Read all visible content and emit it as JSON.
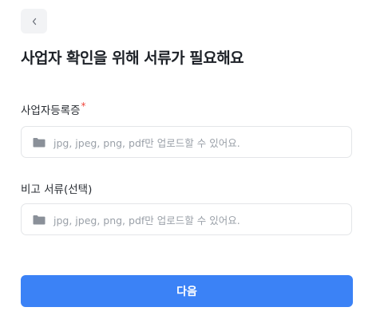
{
  "header": {
    "back_icon": "chevron-left-icon",
    "title": "사업자 확인을 위해 서류가 필요해요"
  },
  "business_registration": {
    "label": "사업자등록증",
    "required_mark": "*",
    "icon": "folder-icon",
    "placeholder": "jpg, jpeg, png, pdf만 업로드할 수 있어요."
  },
  "note_document": {
    "label": "비고 서류(선택)",
    "icon": "folder-icon",
    "placeholder": "jpg, jpeg, png, pdf만 업로드할 수 있어요."
  },
  "footer": {
    "next_label": "다음"
  },
  "colors": {
    "primary": "#3b82f6",
    "required": "#f0443a",
    "placeholder": "#9aa0a8",
    "icon": "#8a9099"
  }
}
